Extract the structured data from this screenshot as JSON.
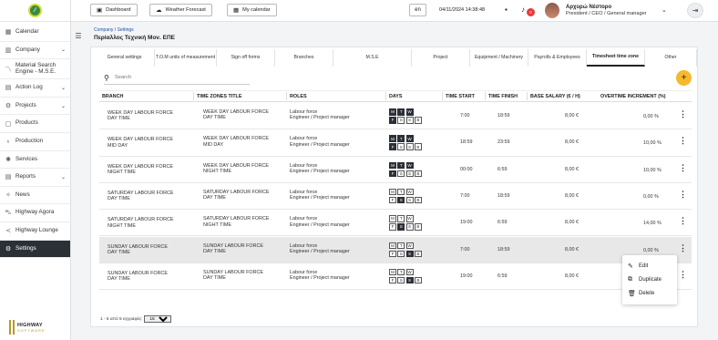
{
  "sidebar": {
    "items": [
      {
        "label": "Calendar",
        "icon": "calendar-icon",
        "glyph": "▦",
        "chev": ""
      },
      {
        "label": "Company",
        "icon": "building-icon",
        "glyph": "▥",
        "chev": "⌄"
      },
      {
        "label": "Material Search Engine - M.S.E.",
        "icon": "chart-icon",
        "glyph": "〽",
        "chev": ""
      },
      {
        "label": "Action Log",
        "icon": "bar-chart-icon",
        "glyph": "▤",
        "chev": "⌄"
      },
      {
        "label": "Projects",
        "icon": "gear-icon",
        "glyph": "⚙",
        "chev": "⌄"
      },
      {
        "label": "Products",
        "icon": "box-icon",
        "glyph": "▢",
        "chev": ""
      },
      {
        "label": "Production",
        "icon": "bulb-icon",
        "glyph": "♁",
        "chev": ""
      },
      {
        "label": "Services",
        "icon": "services-icon",
        "glyph": "✺",
        "chev": ""
      },
      {
        "label": "Reports",
        "icon": "reports-icon",
        "glyph": "▤",
        "chev": "⌄"
      },
      {
        "label": "News",
        "icon": "news-icon",
        "glyph": "✧",
        "chev": ""
      },
      {
        "label": "Highway Agora",
        "icon": "cart-icon",
        "glyph": "⛍",
        "chev": ""
      },
      {
        "label": "Highway Lounge",
        "icon": "share-icon",
        "glyph": "≺",
        "chev": ""
      },
      {
        "label": "Settings",
        "icon": "settings-icon",
        "glyph": "⚙",
        "chev": ""
      }
    ],
    "brand": {
      "name": "HIGHWAY",
      "sub": "SOFTWARE"
    }
  },
  "topbar": {
    "dashboard": "Dashboard",
    "weather": "Weather Forecast",
    "calendar": "My calendar",
    "lang": "en",
    "datetime": "04/11/2024 14:38:48",
    "notif_count": "0",
    "user_name": "Αρχυρώ Νέστορο",
    "user_role": "President / CEO / General manager"
  },
  "header": {
    "breadcrumb": "Company / Settings",
    "company": "Περίαλλος Τεχνική Μον. ΕΠΕ"
  },
  "tabs": [
    {
      "label": "General settings",
      "w": 66
    },
    {
      "label": "T.O.M units of measurement",
      "w": 68
    },
    {
      "label": "Sign off forms",
      "w": 64
    },
    {
      "label": "Branches",
      "w": 64
    },
    {
      "label": "M.S.E",
      "w": 86
    },
    {
      "label": "Project",
      "w": 64
    },
    {
      "label": "Equipment / Machinery",
      "w": 64
    },
    {
      "label": "Payrolls & Employees",
      "w": 64
    },
    {
      "label": "Timesheet time zone",
      "w": 64,
      "active": true
    },
    {
      "label": "Other",
      "w": 57
    }
  ],
  "search": {
    "placeholder": "Search"
  },
  "table": {
    "headers": [
      "BRANCH",
      "TIME ZONES TITLE",
      "ROLES",
      "DAYS",
      "TIME START",
      "TIME FINISH",
      "BASE SALARY (€ / H)",
      "OVERTIME INCREMENT (%)"
    ],
    "rows": [
      {
        "branch": "WEEK DAY LABOUR FORCE\nDAY TIME",
        "title": "WEEK DAY LABOUR FORCE\nDAY TIME",
        "roles": "Labour force\nEngineer / Project manager",
        "days": [
          "M",
          "T",
          "W",
          "T",
          "F",
          "S",
          "S",
          "B"
        ],
        "on": [
          1,
          1,
          1,
          1,
          1,
          0,
          0,
          0
        ],
        "start": "7:00",
        "finish": "18:59",
        "salary": "8,00 €",
        "overtime": "0,00 %"
      },
      {
        "branch": "WEEK DAY LABOUR FORCE\nMID DAY",
        "title": "WEEK DAY LABOUR FORCE\nMID DAY",
        "roles": "Labour force\nEngineer / Project manager",
        "days": [
          "M",
          "T",
          "W",
          "T",
          "F",
          "S",
          "S",
          "B"
        ],
        "on": [
          1,
          1,
          1,
          1,
          1,
          0,
          0,
          0
        ],
        "start": "18:59",
        "finish": "23:59",
        "salary": "8,00 €",
        "overtime": "10,00 %"
      },
      {
        "branch": "WEEK DAY LABOUR FORCE\nNIGHT TIME",
        "title": "WEEK DAY LABOUR FORCE\nNIGHT TIME",
        "roles": "Labour force\nEngineer / Project manager",
        "days": [
          "M",
          "T",
          "W",
          "T",
          "F",
          "S",
          "S",
          "B"
        ],
        "on": [
          1,
          1,
          1,
          1,
          1,
          0,
          0,
          0
        ],
        "start": "00:00",
        "finish": "6:59",
        "salary": "8,00 €",
        "overtime": "10,00 %"
      },
      {
        "branch": "SATURDAY LABOUR FORCE\nDAY TIME",
        "title": "SATURDAY LABOUR FORCE\nDAY TIME",
        "roles": "Labour force\nEngineer / Project manager",
        "days": [
          "M",
          "T",
          "W",
          "T",
          "F",
          "S",
          "S",
          "B"
        ],
        "on": [
          0,
          0,
          0,
          0,
          0,
          1,
          0,
          0
        ],
        "start": "7:00",
        "finish": "18:59",
        "salary": "8,00 €",
        "overtime": "0,00 %"
      },
      {
        "branch": "SATURDAY LABOUR FORCE\nNIGHT TIME",
        "title": "SATURDAY LABOUR FORCE\nNIGHT TIME",
        "roles": "Labour force\nEngineer / Project manager",
        "days": [
          "M",
          "T",
          "W",
          "T",
          "F",
          "S",
          "S",
          "B"
        ],
        "on": [
          0,
          0,
          0,
          0,
          0,
          1,
          0,
          0
        ],
        "start": "19:00",
        "finish": "6:59",
        "salary": "8,00 €",
        "overtime": "14,00 %"
      },
      {
        "branch": "SUNDAY LABOUR FORCE\nDAY TIME",
        "title": "SUNDAY LABOUR FORCE\nDAY TIME",
        "roles": "Labour force\nEngineer / Project manager",
        "days": [
          "M",
          "T",
          "W",
          "T",
          "F",
          "S",
          "S",
          "B"
        ],
        "on": [
          0,
          0,
          0,
          0,
          0,
          0,
          1,
          0
        ],
        "start": "7:00",
        "finish": "18:59",
        "salary": "8,00 €",
        "overtime": "0,00 %",
        "highlight": true
      },
      {
        "branch": "SUNDAY LABOUR FORCE\nDAY TIME",
        "title": "SUNDAY LABOUR FORCE\nDAY TIME",
        "roles": "Labour force\nEngineer / Project manager",
        "days": [
          "M",
          "T",
          "W",
          "T",
          "F",
          "S",
          "S",
          "B"
        ],
        "on": [
          0,
          0,
          0,
          0,
          0,
          0,
          1,
          0
        ],
        "start": "19:00",
        "finish": "6:59",
        "salary": "8,00 €",
        "overtime": ""
      }
    ]
  },
  "pager": {
    "text": "1 - 5 από 5 εγγραφές:",
    "per_page": "15"
  },
  "context_menu": {
    "edit": "Edit",
    "duplicate": "Duplicate",
    "delete": "Delete"
  }
}
